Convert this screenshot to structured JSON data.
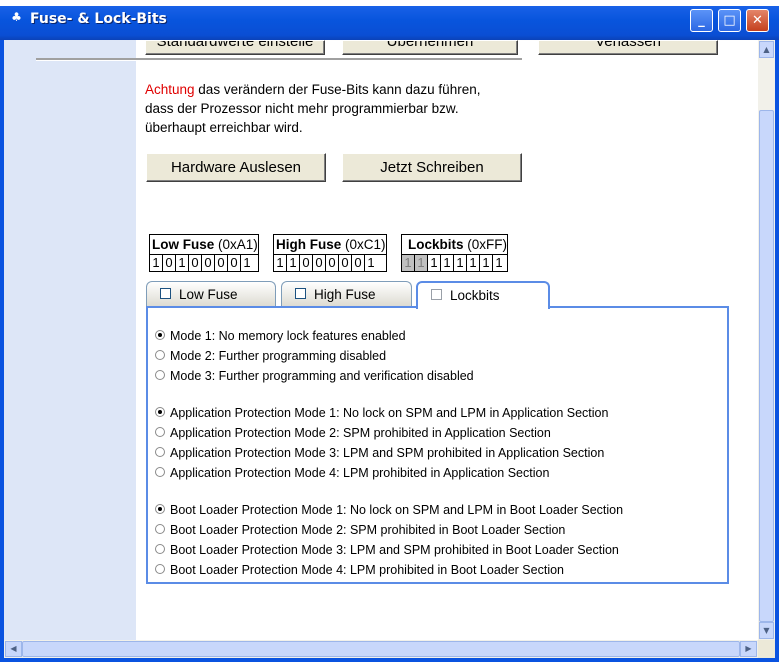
{
  "window": {
    "title": "Fuse- & Lock-Bits",
    "minimize_glyph": "_",
    "maximize_glyph": "□",
    "close_glyph": "✕"
  },
  "top_buttons": [
    "Standardwerte einstelle",
    "Übernehmen",
    "Verlassen"
  ],
  "warning": {
    "highlight": "Achtung",
    "text_line1": " das verändern der Fuse-Bits kann dazu führen,",
    "text_line2": "dass der Prozessor nicht mehr programmierbar bzw.",
    "text_line3": "überhaupt erreichbar wird."
  },
  "actions": {
    "read_label": "Hardware Auslesen",
    "write_label": "Jetzt Schreiben"
  },
  "fuses": [
    {
      "name": "Low Fuse",
      "hex": "(0xA1)",
      "bits": [
        "1",
        "0",
        "1",
        "0",
        "0",
        "0",
        "0",
        "1"
      ],
      "disabled_bits": []
    },
    {
      "name": "High Fuse",
      "hex": "(0xC1)",
      "bits": [
        "1",
        "1",
        "0",
        "0",
        "0",
        "0",
        "0",
        "1"
      ],
      "disabled_bits": []
    },
    {
      "name": "Lockbits",
      "hex": "(0xFF)",
      "bits": [
        "1",
        "1",
        "1",
        "1",
        "1",
        "1",
        "1",
        "1"
      ],
      "disabled_bits": [
        0,
        1
      ]
    }
  ],
  "tabs": [
    {
      "label": "Low Fuse",
      "active": false
    },
    {
      "label": "High Fuse",
      "active": false
    },
    {
      "label": "Lockbits",
      "active": true
    }
  ],
  "options": [
    {
      "label": "Mode 1: No memory lock features enabled",
      "selected": true
    },
    {
      "label": "Mode 2: Further programming disabled",
      "selected": false
    },
    {
      "label": "Mode 3: Further programming and verification disabled",
      "selected": false
    },
    {
      "label": "Application Protection Mode 1: No lock on SPM and LPM in Application Section",
      "selected": true
    },
    {
      "label": "Application Protection Mode 2: SPM prohibited in Application Section",
      "selected": false
    },
    {
      "label": "Application Protection Mode 3: LPM and SPM prohibited in Application Section",
      "selected": false
    },
    {
      "label": "Application Protection Mode 4: LPM prohibited in Application Section",
      "selected": false
    },
    {
      "label": "Boot Loader Protection Mode 1: No lock on SPM and LPM in Boot Loader Section",
      "selected": true
    },
    {
      "label": "Boot Loader Protection Mode 2: SPM prohibited in Boot Loader Section",
      "selected": false
    },
    {
      "label": "Boot Loader Protection Mode 3: LPM and SPM prohibited in Boot Loader Section",
      "selected": false
    },
    {
      "label": "Boot Loader Protection Mode 4: LPM prohibited in Boot Loader Section",
      "selected": false
    }
  ],
  "colors": {
    "warning_red": "#e00000",
    "tab_border": "#5b8ce6",
    "titlebar": "#0855dd"
  }
}
